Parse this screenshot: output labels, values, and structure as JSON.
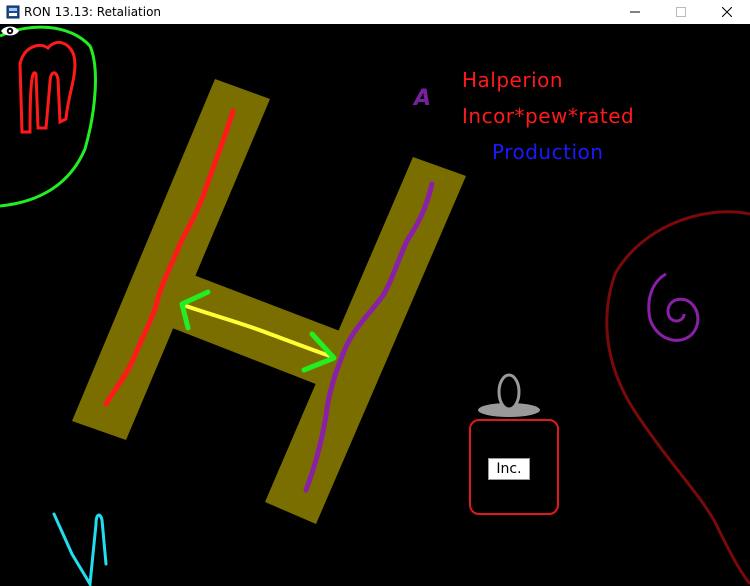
{
  "window": {
    "title": "RON 13.13: Retaliation",
    "controls": {
      "minimize": "minimize-icon",
      "maximize": "maximize-icon",
      "close": "close-icon"
    }
  },
  "canvas": {
    "background": "#000000",
    "credits": {
      "article": "A",
      "line1": "Halperion",
      "line2": "Incor*pew*rated",
      "line3": "Production"
    },
    "logo_letter": "H",
    "inc_label": "Inc.",
    "eye_icon": "eye-icon",
    "colors": {
      "h_fill": "#7a6e00",
      "red": "#ff1a1a",
      "purple": "#7b1fa2",
      "yellow": "#ffff33",
      "green": "#22ee22",
      "cyan": "#22ddee",
      "darkred": "#7a0a0a",
      "blue": "#1a1aff"
    }
  }
}
